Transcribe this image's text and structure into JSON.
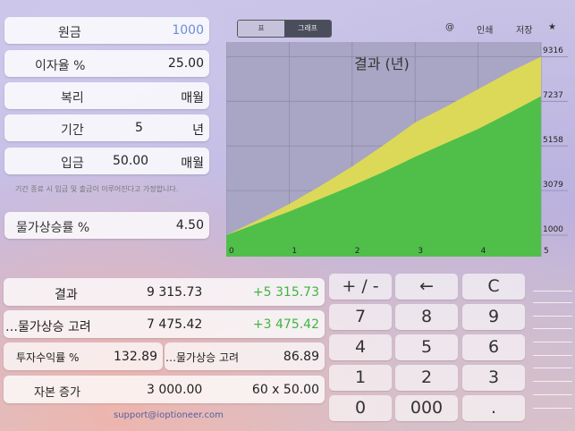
{
  "inputs": {
    "principal": {
      "label": "원금",
      "value": "1000"
    },
    "rate": {
      "label": "이자율 %",
      "value": "25.00"
    },
    "compound": {
      "label": "복리",
      "value": "매월"
    },
    "period": {
      "label": "기간",
      "value": "5",
      "unit": "년"
    },
    "deposit": {
      "label": "입금",
      "value": "50.00",
      "freq": "매월"
    },
    "note": "기간 종료 시 입금 및 출금이 이루어진다고 가정합니다.",
    "inflation": {
      "label": "물가상승률 %",
      "value": "4.50"
    }
  },
  "toolbar": {
    "seg_table": "표",
    "seg_chart": "그래프",
    "at": "@",
    "print": "인쇄",
    "save": "저장",
    "star": "★"
  },
  "chart_data": {
    "type": "area",
    "title": "결과 (년)",
    "x_ticks": [
      "0",
      "1",
      "2",
      "3",
      "4",
      "5"
    ],
    "y_ticks": [
      "9316",
      "7237",
      "5158",
      "3079",
      "1000"
    ],
    "ylim": [
      0,
      10000
    ],
    "xlim": [
      0,
      5
    ],
    "series": [],
    "x": [
      0,
      0.5,
      1,
      1.5,
      2,
      2.5,
      3,
      3.5,
      4,
      4.5,
      5
    ],
    "nominal": [
      1000,
      1700,
      2450,
      3300,
      4200,
      5200,
      6250,
      7000,
      7800,
      8600,
      9316
    ],
    "real": [
      1000,
      1550,
      2100,
      2700,
      3300,
      3950,
      4650,
      5300,
      5950,
      6700,
      7475
    ],
    "colors": {
      "nominal": "#dcd958",
      "real": "#4fbf4a",
      "bg": "#a8a6c4",
      "grid": "#8e8cab"
    }
  },
  "results": {
    "result": {
      "label": "결과",
      "value": "9 315.73",
      "gain": "+5 315.73"
    },
    "inflation_adj": {
      "label": "…물가상승 고려",
      "value": "7 475.42",
      "gain": "+3 475.42"
    },
    "roi": {
      "label": "투자수익률 %",
      "value": "132.89"
    },
    "roi_adj": {
      "label": "…물가상승 고려",
      "value": "86.89"
    },
    "capital": {
      "label": "자본 증가",
      "value": "3 000.00",
      "detail": "60 x 50.00"
    }
  },
  "keypad": [
    "+ / -",
    "←",
    "C",
    "7",
    "8",
    "9",
    "4",
    "5",
    "6",
    "1",
    "2",
    "3",
    "0",
    "000",
    "."
  ],
  "support": "support@ioptioneer.com"
}
